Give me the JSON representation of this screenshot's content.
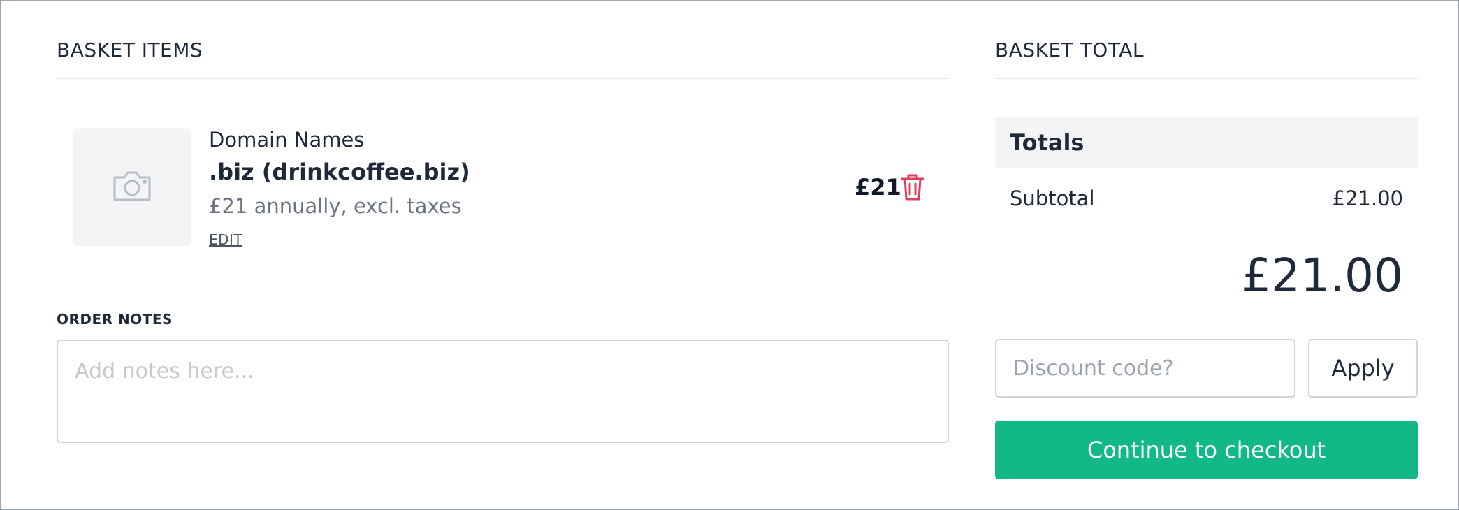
{
  "basket_items": {
    "title": "BASKET ITEMS",
    "items": [
      {
        "category": "Domain Names",
        "name": ".biz (drinkcoffee.biz)",
        "price_description": "£21 annually, excl. taxes",
        "edit_label": "EDIT",
        "price": "£21",
        "thumbnail_icon": "camera-icon",
        "remove_icon": "trash-icon"
      }
    ]
  },
  "order_notes": {
    "label": "ORDER NOTES",
    "placeholder": "Add notes here...",
    "value": ""
  },
  "basket_total": {
    "title": "BASKET TOTAL",
    "totals_header": "Totals",
    "subtotal_label": "Subtotal",
    "subtotal_value": "£21.00",
    "grand_total": "£21.00",
    "discount_placeholder": "Discount code?",
    "apply_label": "Apply",
    "checkout_label": "Continue to checkout"
  },
  "colors": {
    "accent": "#12b886",
    "danger": "#e03e5e",
    "panel": "#f3f4f6",
    "border": "#d1d5db"
  }
}
